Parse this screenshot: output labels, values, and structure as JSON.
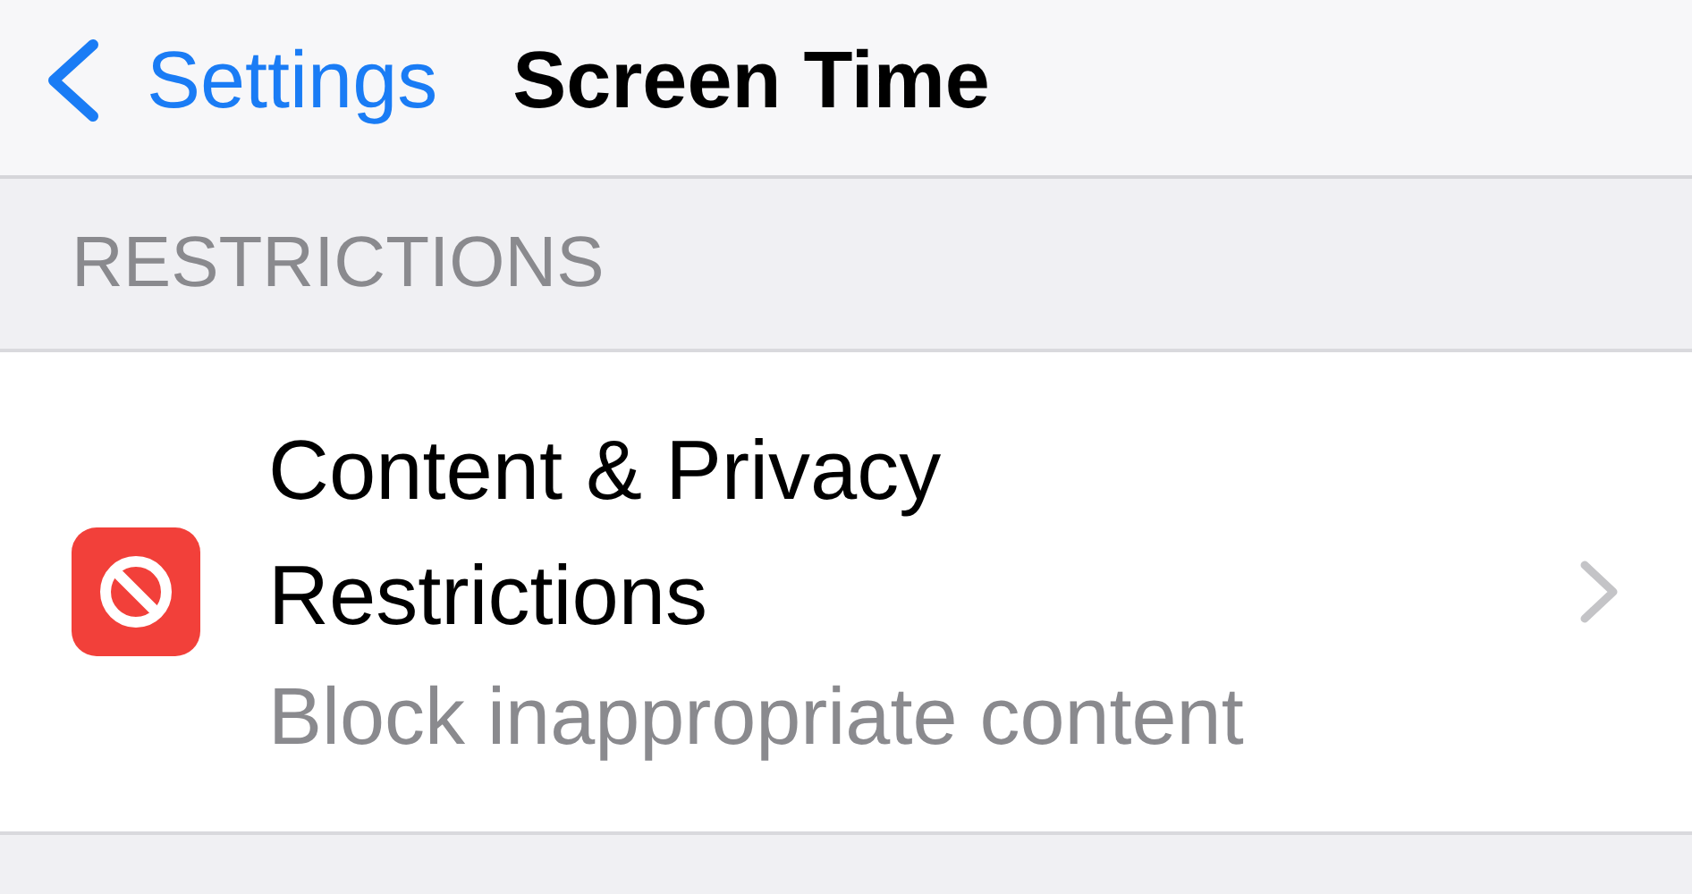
{
  "nav_bar": {
    "back_label": "Settings",
    "title": "Screen Time"
  },
  "section": {
    "header": "RESTRICTIONS",
    "rows": [
      {
        "title": "Content & Privacy Restrictions",
        "subtitle": "Block inappropriate content"
      }
    ]
  }
}
